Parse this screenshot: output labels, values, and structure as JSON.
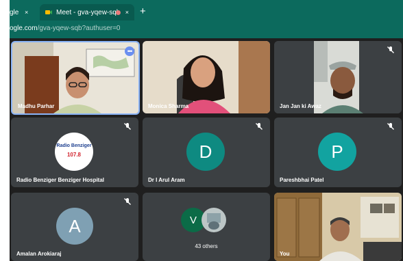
{
  "browser": {
    "prev_tab_label": "gle",
    "prev_tab_close": "×",
    "active_tab_title": "Meet - gva-yqew-sqb",
    "active_tab_close": "×",
    "new_tab": "+",
    "url_host": "ogle.com",
    "url_path": "/gva-yqew-sqb?authuser=0"
  },
  "participants": [
    {
      "name": "Madhu Parhar",
      "more_label": "•••"
    },
    {
      "name": "Monica Sharma"
    },
    {
      "name": "Jan Jan ki Awaz"
    },
    {
      "name": "Radio Benziger Benziger Hospital",
      "logo_text": "Radio Benziger",
      "logo_freq": "107.8"
    },
    {
      "name": "Dr I Arul Aram",
      "initial": "D"
    },
    {
      "name": "Pareshbhai Patel",
      "initial": "P"
    },
    {
      "name": "Amalan Arokiaraj",
      "initial": "A"
    },
    {
      "name": "",
      "initial": "V",
      "others_label": "43 others"
    },
    {
      "name": "You"
    }
  ],
  "colors": {
    "chrome": "#0c6a5d",
    "tile": "#3c4043",
    "avatar_d": "#0e8a81",
    "avatar_p": "#12a3a0",
    "avatar_a": "#7fa0b3",
    "avatar_v": "#0b6b47"
  }
}
